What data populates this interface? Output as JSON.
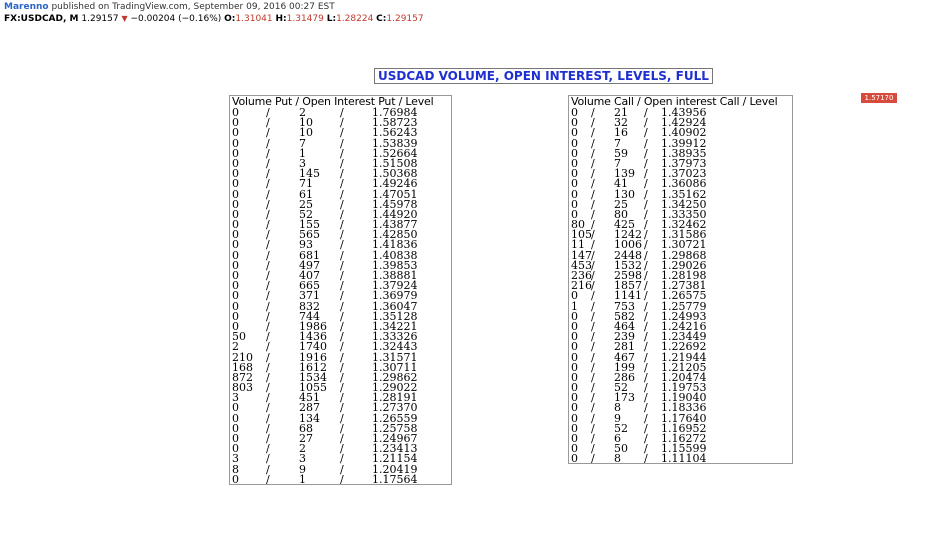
{
  "header": {
    "author": "Marenno",
    "published_text": "published on TradingView.com, September 09, 2016 00:27 EST",
    "symbol": "FX:USDCAD, M",
    "price": "1.29157",
    "change": "−0.00204 (−0.16%)",
    "open_label": "O:",
    "open": "1.31041",
    "high_label": "H:",
    "high": "1.31479",
    "low_label": "L:",
    "low": "1.28224",
    "close_label": "C:",
    "close": "1.29157",
    "down_color": "#c0392b"
  },
  "title": "USDCAD VOLUME, OPEN INTEREST, LEVELS, FULL",
  "price_badge": "1.57170",
  "put_table": {
    "header": "Volume Put / Open Interest Put / Level",
    "separator": "/",
    "rows": [
      [
        "0",
        "2",
        "1.76984"
      ],
      [
        "0",
        "10",
        "1.58723"
      ],
      [
        "0",
        "10",
        "1.56243"
      ],
      [
        "0",
        "7",
        "1.53839"
      ],
      [
        "0",
        "1",
        "1.52664"
      ],
      [
        "0",
        "3",
        "1.51508"
      ],
      [
        "0",
        "145",
        "1.50368"
      ],
      [
        "0",
        "71",
        "1.49246"
      ],
      [
        "0",
        "61",
        "1.47051"
      ],
      [
        "0",
        "25",
        "1.45978"
      ],
      [
        "0",
        "52",
        "1.44920"
      ],
      [
        "0",
        "155",
        "1.43877"
      ],
      [
        "0",
        "565",
        "1.42850"
      ],
      [
        "0",
        "93",
        "1.41836"
      ],
      [
        "0",
        "681",
        "1.40838"
      ],
      [
        "0",
        "497",
        "1.39853"
      ],
      [
        "0",
        "407",
        "1.38881"
      ],
      [
        "0",
        "665",
        "1.37924"
      ],
      [
        "0",
        "371",
        "1.36979"
      ],
      [
        "0",
        "832",
        "1.36047"
      ],
      [
        "0",
        "744",
        "1.35128"
      ],
      [
        "0",
        "1986",
        "1.34221"
      ],
      [
        "50",
        "1436",
        "1.33326"
      ],
      [
        "2",
        "1740",
        "1.32443"
      ],
      [
        "210",
        "1916",
        "1.31571"
      ],
      [
        "168",
        "1612",
        "1.30711"
      ],
      [
        "872",
        "1534",
        "1.29862"
      ],
      [
        "803",
        "1055",
        "1.29022"
      ],
      [
        "3",
        "451",
        "1.28191"
      ],
      [
        "0",
        "287",
        "1.27370"
      ],
      [
        "0",
        "134",
        "1.26559"
      ],
      [
        "0",
        "68",
        "1.25758"
      ],
      [
        "0",
        "27",
        "1.24967"
      ],
      [
        "0",
        "2",
        "1.23413"
      ],
      [
        "3",
        "3",
        "1.21154"
      ],
      [
        "8",
        "9",
        "1.20419"
      ],
      [
        "0",
        "1",
        "1.17564"
      ]
    ]
  },
  "call_table": {
    "header": "Volume Call / Open interest Call / Level",
    "separator": "/",
    "rows": [
      [
        "0",
        "21",
        "1.43956"
      ],
      [
        "0",
        "32",
        "1.42924"
      ],
      [
        "0",
        "16",
        "1.40902"
      ],
      [
        "0",
        "7",
        "1.39912"
      ],
      [
        "0",
        "59",
        "1.38935"
      ],
      [
        "0",
        "7",
        "1.37973"
      ],
      [
        "0",
        "139",
        "1.37023"
      ],
      [
        "0",
        "41",
        "1.36086"
      ],
      [
        "0",
        "130",
        "1.35162"
      ],
      [
        "0",
        "25",
        "1.34250"
      ],
      [
        "0",
        "80",
        "1.33350"
      ],
      [
        "80",
        "425",
        "1.32462"
      ],
      [
        "105",
        "1242",
        "1.31586"
      ],
      [
        "11",
        "1006",
        "1.30721"
      ],
      [
        "147",
        "2448",
        "1.29868"
      ],
      [
        "453",
        "1532",
        "1.29026"
      ],
      [
        "236",
        "2598",
        "1.28198"
      ],
      [
        "216",
        "1857",
        "1.27381"
      ],
      [
        "0",
        "1141",
        "1.26575"
      ],
      [
        "1",
        "753",
        "1.25779"
      ],
      [
        "0",
        "582",
        "1.24993"
      ],
      [
        "0",
        "464",
        "1.24216"
      ],
      [
        "0",
        "239",
        "1.23449"
      ],
      [
        "0",
        "281",
        "1.22692"
      ],
      [
        "0",
        "467",
        "1.21944"
      ],
      [
        "0",
        "199",
        "1.21205"
      ],
      [
        "0",
        "286",
        "1.20474"
      ],
      [
        "0",
        "52",
        "1.19753"
      ],
      [
        "0",
        "173",
        "1.19040"
      ],
      [
        "0",
        "8",
        "1.18336"
      ],
      [
        "0",
        "9",
        "1.17640"
      ],
      [
        "0",
        "52",
        "1.16952"
      ],
      [
        "0",
        "6",
        "1.16272"
      ],
      [
        "0",
        "50",
        "1.15599"
      ],
      [
        "0",
        "8",
        "1.11104"
      ]
    ]
  }
}
